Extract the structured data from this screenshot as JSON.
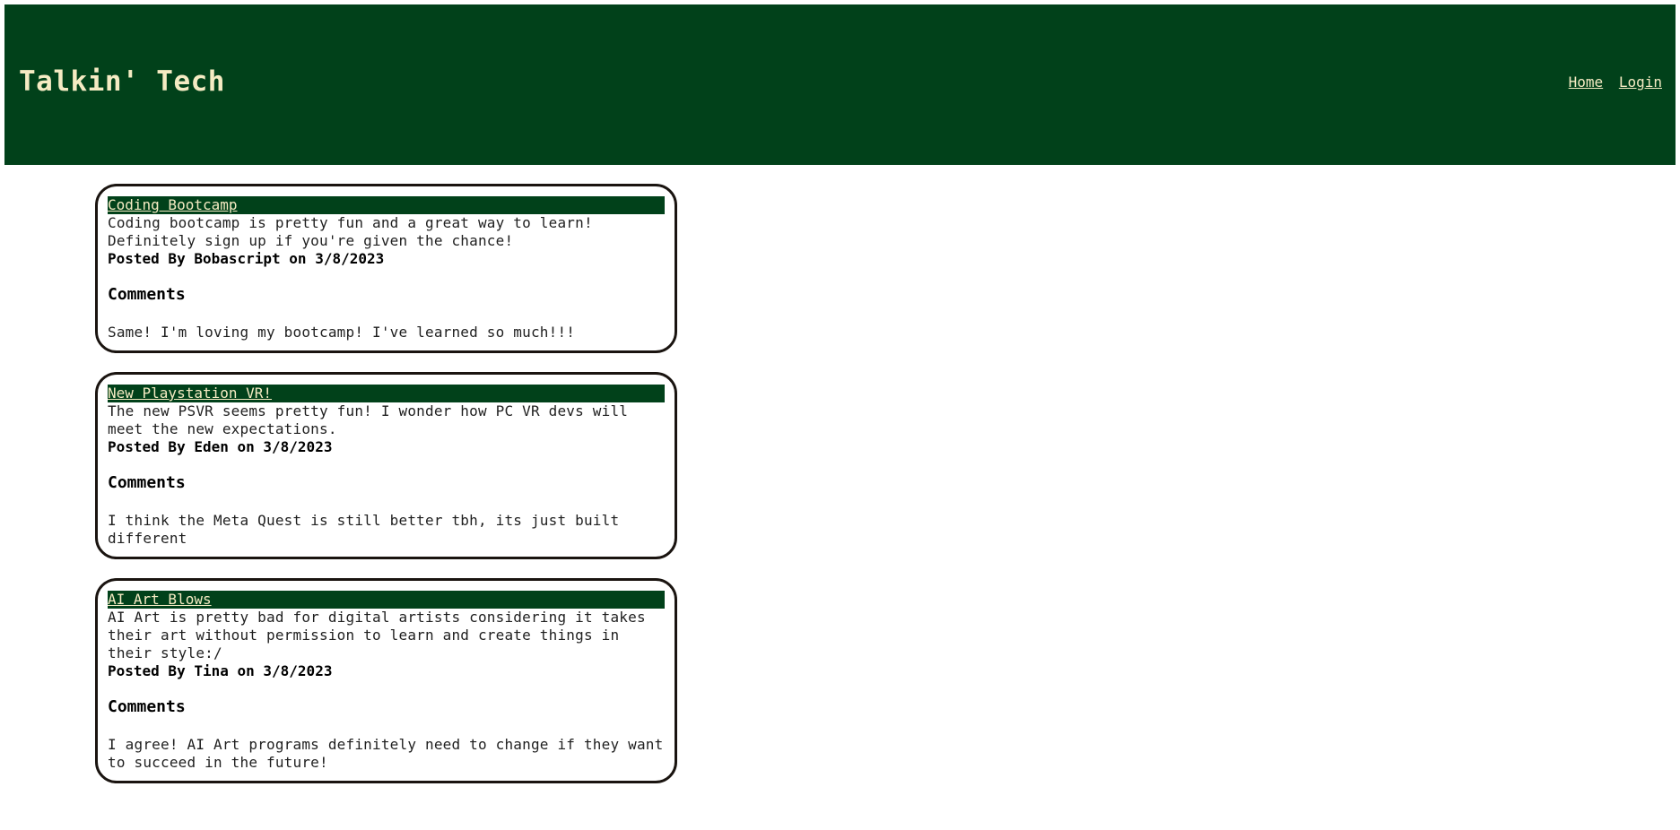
{
  "header": {
    "title": "Talkin' Tech",
    "nav": [
      {
        "label": "Home"
      },
      {
        "label": "Login"
      }
    ]
  },
  "posts": [
    {
      "title": "Coding Bootcamp",
      "body": "Coding bootcamp is pretty fun and a great way to learn! Definitely sign up if you're given the chance!",
      "meta": "Posted By Bobascript on 3/8/2023",
      "comments_heading": "Comments",
      "comments": [
        "Same! I'm loving my bootcamp! I've learned so much!!!"
      ]
    },
    {
      "title": "New Playstation VR!",
      "body": "The new PSVR seems pretty fun! I wonder how PC VR devs will meet the new expectations.",
      "meta": "Posted By Eden on 3/8/2023",
      "comments_heading": "Comments",
      "comments": [
        "I think the Meta Quest is still better tbh, its just built different"
      ]
    },
    {
      "title": "AI Art Blows",
      "body": "AI Art is pretty bad for digital artists considering it takes their art without permission to learn and create things in their style:/",
      "meta": "Posted By Tina on 3/8/2023",
      "comments_heading": "Comments",
      "comments": [
        "I agree! AI Art programs definitely need to change if they want to succeed in the future!"
      ]
    }
  ],
  "colors": {
    "header_bg": "#01411a",
    "header_text": "#f5ebc3",
    "card_border": "#1a1410"
  }
}
